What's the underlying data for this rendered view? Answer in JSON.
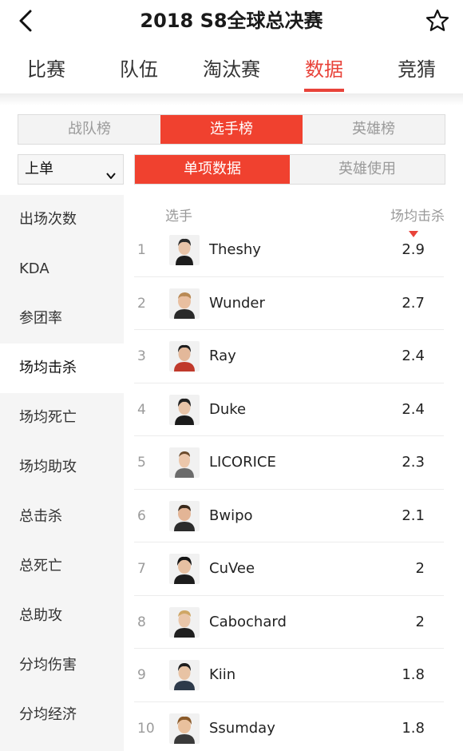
{
  "header": {
    "title": "2018 S8全球总决赛"
  },
  "tabs": [
    {
      "label": "比赛"
    },
    {
      "label": "队伍"
    },
    {
      "label": "淘汰赛"
    },
    {
      "label": "数据"
    },
    {
      "label": "竞猜"
    }
  ],
  "ranking_tabs": [
    {
      "label": "战队榜"
    },
    {
      "label": "选手榜"
    },
    {
      "label": "英雄榜"
    }
  ],
  "position_select": {
    "value": "上单"
  },
  "data_tabs": [
    {
      "label": "单项数据"
    },
    {
      "label": "英雄使用"
    }
  ],
  "sidebar": {
    "items": [
      {
        "label": "出场次数"
      },
      {
        "label": "KDA"
      },
      {
        "label": "参团率"
      },
      {
        "label": "场均击杀"
      },
      {
        "label": "场均死亡"
      },
      {
        "label": "场均助攻"
      },
      {
        "label": "总击杀"
      },
      {
        "label": "总死亡"
      },
      {
        "label": "总助攻"
      },
      {
        "label": "分均伤害"
      },
      {
        "label": "分均经济"
      }
    ]
  },
  "table": {
    "col_player": "选手",
    "col_stat": "场均击杀",
    "rows": [
      {
        "rank": "1",
        "name": "Theshy",
        "value": "2.9"
      },
      {
        "rank": "2",
        "name": "Wunder",
        "value": "2.7"
      },
      {
        "rank": "3",
        "name": "Ray",
        "value": "2.4"
      },
      {
        "rank": "4",
        "name": "Duke",
        "value": "2.4"
      },
      {
        "rank": "5",
        "name": "LICORICE",
        "value": "2.3"
      },
      {
        "rank": "6",
        "name": "Bwipo",
        "value": "2.1"
      },
      {
        "rank": "7",
        "name": "CuVee",
        "value": "2"
      },
      {
        "rank": "8",
        "name": "Cabochard",
        "value": "2"
      },
      {
        "rank": "9",
        "name": "Kiin",
        "value": "1.8"
      },
      {
        "rank": "10",
        "name": "Ssumday",
        "value": "1.8"
      }
    ]
  },
  "colors": {
    "accent": "#f0412f",
    "tab_active": "#e8433a"
  }
}
